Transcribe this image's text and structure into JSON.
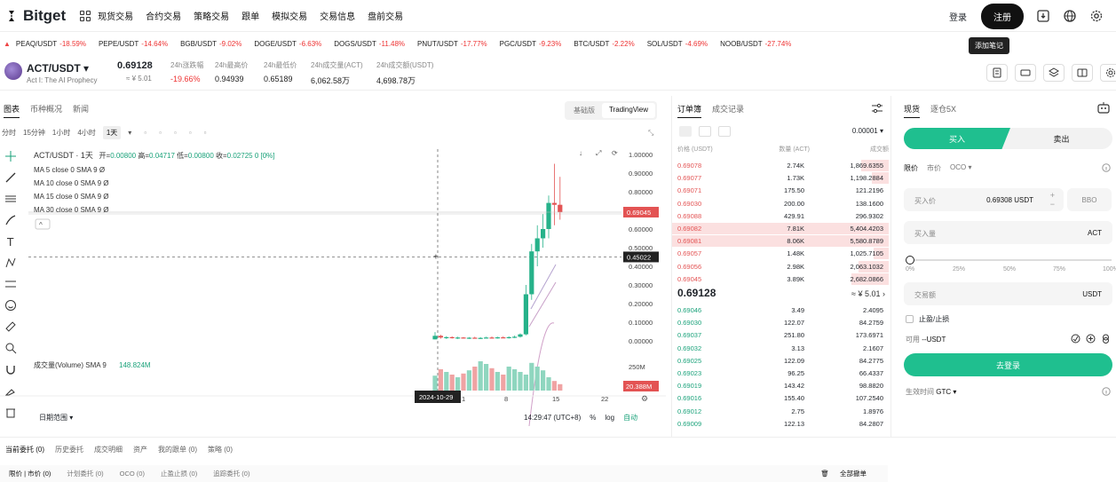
{
  "header": {
    "brand": "Bitget",
    "nav": [
      "现货交易",
      "合约交易",
      "策略交易",
      "跟单",
      "模拟交易",
      "交易信息",
      "盘前交易"
    ],
    "login": "登录",
    "register": "注册"
  },
  "ticker": [
    {
      "pair": "PEAQ/USDT",
      "change": "-18.59%"
    },
    {
      "pair": "PEPE/USDT",
      "change": "-14.64%"
    },
    {
      "pair": "BGB/USDT",
      "change": "-9.02%"
    },
    {
      "pair": "DOGE/USDT",
      "change": "-6.63%"
    },
    {
      "pair": "DOGS/USDT",
      "change": "-11.48%"
    },
    {
      "pair": "PNUT/USDT",
      "change": "-17.77%"
    },
    {
      "pair": "PGC/USDT",
      "change": "-9.23%"
    },
    {
      "pair": "BTC/USDT",
      "change": "-2.22%"
    },
    {
      "pair": "SOL/USDT",
      "change": "-4.69%"
    },
    {
      "pair": "NOOB/USDT",
      "change": "-27.74%"
    }
  ],
  "tooltip": "添加笔记",
  "pair": {
    "name": "ACT/USDT",
    "subtitle": "Act I: The AI Prophecy",
    "price": "0.69128",
    "price_cny": "≈ ¥ 5.01",
    "stats": [
      {
        "label": "24h涨跌幅",
        "value": "-19.66%",
        "color": "#e33"
      },
      {
        "label": "24h最高价",
        "value": "0.94939",
        "color": "#222"
      },
      {
        "label": "24h最低价",
        "value": "0.65189",
        "color": "#222"
      },
      {
        "label": "24h成交量(ACT)",
        "value": "6,062.58万",
        "color": "#222"
      },
      {
        "label": "24h成交额(USDT)",
        "value": "4,698.78万",
        "color": "#222"
      }
    ]
  },
  "chart_panel": {
    "tabs": [
      "图表",
      "币种概况",
      "新闻"
    ],
    "views": [
      "基础版",
      "TradingView"
    ],
    "timeframes": [
      "分时",
      "15分钟",
      "1小时",
      "4小时",
      "1天"
    ],
    "legend_title": "ACT/USDT · 1天",
    "ohlc": {
      "open_label": "开=",
      "open": "0.00800",
      "high_label": "高=",
      "high": "0.04717",
      "low_label": "低=",
      "low": "0.00800",
      "close_label": "收=",
      "close": "0.02725",
      "chg": "0 [0%]"
    },
    "ma": [
      "MA 5 close 0 SMA 9",
      "MA 10 close 0 SMA 9",
      "MA 15 close 0 SMA 9",
      "MA 30 close 0 SMA 9"
    ],
    "ma_value": "Ø",
    "volume_label": "成交量(Volume) SMA 9",
    "volume_value": "148.824M",
    "crosshair_date": "2024-10-29",
    "x_ticks": [
      "1",
      "8",
      "15",
      "22"
    ],
    "y_ticks": [
      "1.00000",
      "0.90000",
      "0.80000",
      "0.70000",
      "0.60000",
      "0.50000",
      "0.40000",
      "0.30000",
      "0.20000",
      "0.10000",
      "0.00000"
    ],
    "price_tag": "0.69045",
    "crosshair_price": "0.45022",
    "vol_tick": "250M",
    "vol_tag": "20.388M",
    "date_range": "日期范围",
    "time": "14:29:47 (UTC+8)",
    "pct": "%",
    "log": "log",
    "auto": "自动"
  },
  "chart_data": {
    "type": "candlestick",
    "title": "ACT/USDT · 1天",
    "ylim": [
      0,
      1.0
    ],
    "candles": [
      {
        "o": 0.008,
        "h": 0.047,
        "l": 0.008,
        "c": 0.027
      },
      {
        "o": 0.027,
        "h": 0.032,
        "l": 0.012,
        "c": 0.018
      },
      {
        "o": 0.018,
        "h": 0.025,
        "l": 0.01,
        "c": 0.02
      },
      {
        "o": 0.02,
        "h": 0.024,
        "l": 0.012,
        "c": 0.015
      },
      {
        "o": 0.015,
        "h": 0.022,
        "l": 0.01,
        "c": 0.018
      },
      {
        "o": 0.018,
        "h": 0.021,
        "l": 0.012,
        "c": 0.014
      },
      {
        "o": 0.014,
        "h": 0.02,
        "l": 0.01,
        "c": 0.017
      },
      {
        "o": 0.017,
        "h": 0.022,
        "l": 0.012,
        "c": 0.015
      },
      {
        "o": 0.015,
        "h": 0.02,
        "l": 0.01,
        "c": 0.016
      },
      {
        "o": 0.016,
        "h": 0.022,
        "l": 0.012,
        "c": 0.018
      },
      {
        "o": 0.018,
        "h": 0.024,
        "l": 0.012,
        "c": 0.016
      },
      {
        "o": 0.016,
        "h": 0.022,
        "l": 0.012,
        "c": 0.019
      },
      {
        "o": 0.019,
        "h": 0.025,
        "l": 0.014,
        "c": 0.017
      },
      {
        "o": 0.017,
        "h": 0.024,
        "l": 0.012,
        "c": 0.02
      },
      {
        "o": 0.02,
        "h": 0.028,
        "l": 0.015,
        "c": 0.022
      },
      {
        "o": 0.022,
        "h": 0.04,
        "l": 0.018,
        "c": 0.035
      },
      {
        "o": 0.035,
        "h": 0.3,
        "l": 0.03,
        "c": 0.25
      },
      {
        "o": 0.25,
        "h": 0.52,
        "l": 0.22,
        "c": 0.48
      },
      {
        "o": 0.48,
        "h": 0.62,
        "l": 0.4,
        "c": 0.55
      },
      {
        "o": 0.55,
        "h": 0.68,
        "l": 0.5,
        "c": 0.6
      },
      {
        "o": 0.6,
        "h": 0.78,
        "l": 0.55,
        "c": 0.74
      },
      {
        "o": 0.74,
        "h": 0.95,
        "l": 0.62,
        "c": 0.73
      },
      {
        "o": 0.73,
        "h": 0.88,
        "l": 0.65,
        "c": 0.69
      }
    ],
    "volumes": [
      28,
      40,
      35,
      30,
      25,
      32,
      38,
      45,
      55,
      50,
      42,
      35,
      30,
      45,
      40,
      35,
      30,
      52,
      45,
      38,
      25,
      18,
      12
    ]
  },
  "orderbook": {
    "tabs": [
      "订单簿",
      "成交记录"
    ],
    "precision": "0.00001",
    "headers": {
      "price": "价格 (USDT)",
      "amount": "数量 (ACT)",
      "total": "成交额"
    },
    "asks": [
      {
        "price": "0.69078",
        "amount": "2.74K",
        "total": "1,869.6355",
        "depth": 0.36
      },
      {
        "price": "0.69077",
        "amount": "1.73K",
        "total": "1,198.2884",
        "depth": 0.22
      },
      {
        "price": "0.69071",
        "amount": "175.50",
        "total": "121.2196",
        "depth": 0.0
      },
      {
        "price": "0.69030",
        "amount": "200.00",
        "total": "138.1600",
        "depth": 0.0
      },
      {
        "price": "0.69088",
        "amount": "429.91",
        "total": "296.9302",
        "depth": 0.0
      },
      {
        "price": "0.69082",
        "amount": "7.81K",
        "total": "5,404.4203",
        "depth": 1.0
      },
      {
        "price": "0.69081",
        "amount": "8.06K",
        "total": "5,580.8789",
        "depth": 1.0
      },
      {
        "price": "0.69057",
        "amount": "1.48K",
        "total": "1,025.7105",
        "depth": 0.2
      },
      {
        "price": "0.69056",
        "amount": "2.98K",
        "total": "2,063.1032",
        "depth": 0.4
      },
      {
        "price": "0.69045",
        "amount": "3.89K",
        "total": "2,682.0866",
        "depth": 0.5
      }
    ],
    "mid_price": "0.69128",
    "mid_cny": "≈ ¥ 5.01",
    "bids": [
      {
        "price": "0.69046",
        "amount": "3.49",
        "total": "2.4095"
      },
      {
        "price": "0.69030",
        "amount": "122.07",
        "total": "84.2759"
      },
      {
        "price": "0.69037",
        "amount": "251.80",
        "total": "173.6971"
      },
      {
        "price": "0.69032",
        "amount": "3.13",
        "total": "2.1607"
      },
      {
        "price": "0.69025",
        "amount": "122.09",
        "total": "84.2775"
      },
      {
        "price": "0.69023",
        "amount": "96.25",
        "total": "66.4337"
      },
      {
        "price": "0.69019",
        "amount": "143.42",
        "total": "98.8820"
      },
      {
        "price": "0.69016",
        "amount": "155.40",
        "total": "107.2540"
      },
      {
        "price": "0.69012",
        "amount": "2.75",
        "total": "1.8976"
      },
      {
        "price": "0.69009",
        "amount": "122.13",
        "total": "84.2807"
      }
    ]
  },
  "trade": {
    "tabs": [
      "现货",
      "逐仓5X"
    ],
    "buy": "买入",
    "sell": "卖出",
    "order_types": [
      "限价",
      "市价",
      "OCO ▾"
    ],
    "price_label": "买入价",
    "price_value": "0.69308 USDT",
    "bbo": "BBO",
    "amount_label": "买入量",
    "amount_unit": "ACT",
    "slider_marks": [
      "0%",
      "25%",
      "50%",
      "75%",
      "100%"
    ],
    "total_label": "交易额",
    "total_unit": "USDT",
    "tpsl": "止盈/止损",
    "available_label": "可用",
    "available_value": "--USDT",
    "login_button": "去登录",
    "tif_label": "生效时间",
    "tif_value": "GTC ▾"
  },
  "bottom": {
    "tabs": [
      "当前委托 (0)",
      "历史委托",
      "成交明细",
      "资产",
      "我的跟单 (0)",
      "策略 (0)"
    ],
    "subtabs": [
      "限价 | 市价 (0)",
      "计划委托 (0)",
      "OCO (0)",
      "止盈止损 (0)",
      "追踪委托 (0)"
    ],
    "cancel_all": "全部撤单"
  }
}
